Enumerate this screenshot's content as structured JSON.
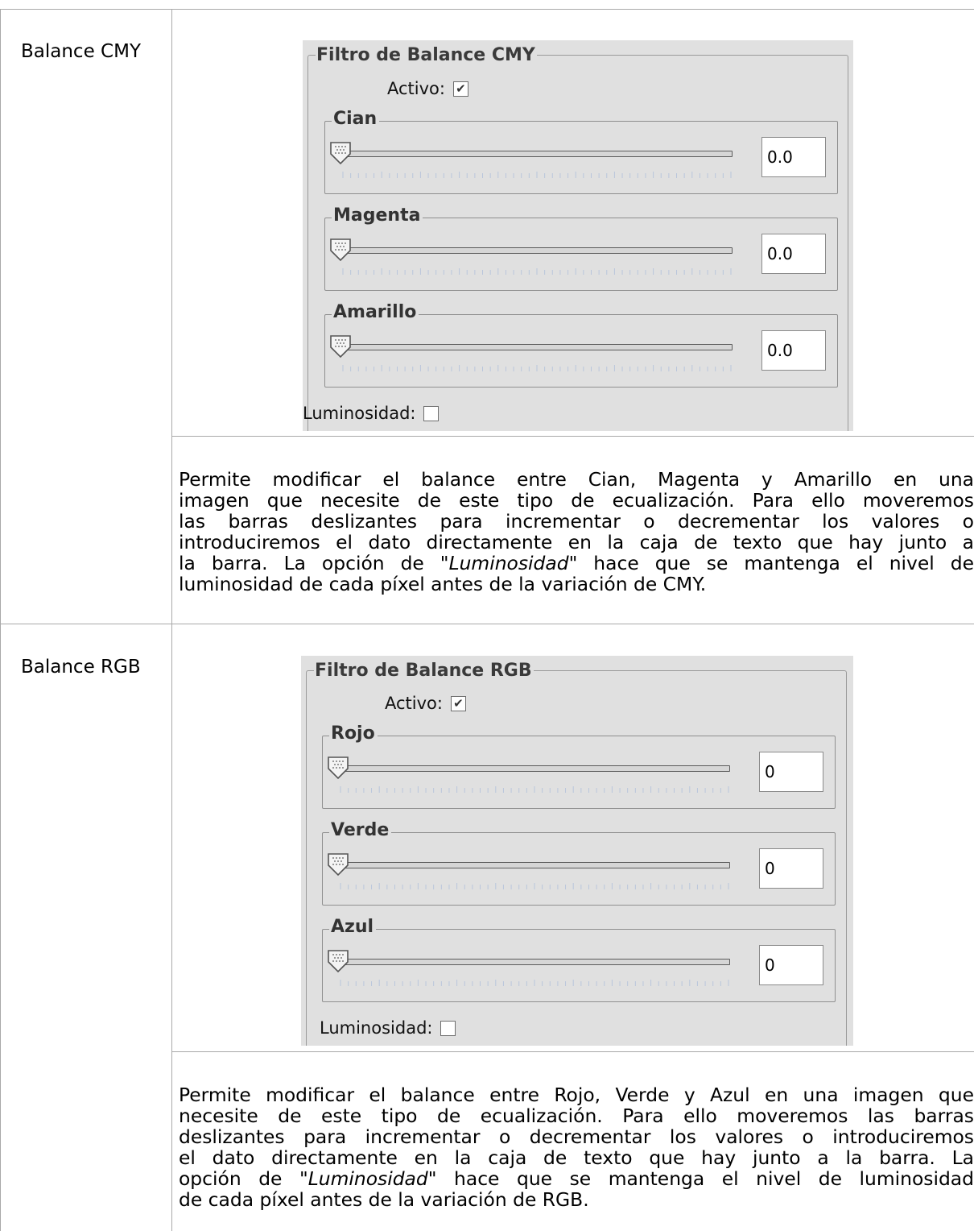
{
  "rows": [
    {
      "label": "Balance CMY",
      "panel": {
        "title": "Filtro de Balance CMY",
        "active_label": "Activo:",
        "active_checked": true,
        "sliders": [
          {
            "label": "Cian",
            "value": "0.0"
          },
          {
            "label": "Magenta",
            "value": "0.0"
          },
          {
            "label": "Amarillo",
            "value": "0.0"
          }
        ],
        "luminosity_label": "Luminosidad:",
        "luminosity_checked": false
      },
      "description_lines": [
        "Permite modificar el balance entre Cian, Magenta y Amarillo en una",
        "imagen que necesite de este tipo de ecualización. Para ello moveremos",
        "las barras deslizantes para incrementar o decrementar los valores o",
        "introduciremos el dato directamente en la caja de texto que hay junto a",
        "la barra. La opción de \"|Luminosidad|\" hace que se mantenga el nivel de",
        "luminosidad de cada píxel antes de la variación de CMY."
      ]
    },
    {
      "label": "Balance RGB",
      "panel": {
        "title": "Filtro de Balance RGB",
        "active_label": "Activo:",
        "active_checked": true,
        "sliders": [
          {
            "label": "Rojo",
            "value": "0"
          },
          {
            "label": "Verde",
            "value": "0"
          },
          {
            "label": "Azul",
            "value": "0"
          }
        ],
        "luminosity_label": "Luminosidad:",
        "luminosity_checked": false
      },
      "description_lines": [
        "Permite modificar el balance entre Rojo, Verde y Azul en una imagen que",
        "necesite de este tipo de ecualización. Para ello moveremos las barras",
        "deslizantes para incrementar o decrementar los valores o introduciremos",
        "el dato directamente en la caja de texto que hay junto a la barra. La",
        "opción de \"|Luminosidad|\" hace que se mantenga el nivel de luminosidad",
        "de cada píxel antes de la variación de RGB."
      ]
    }
  ],
  "colors": {
    "panel_bg": "#e0e0e0",
    "border": "#a9a9a9"
  }
}
